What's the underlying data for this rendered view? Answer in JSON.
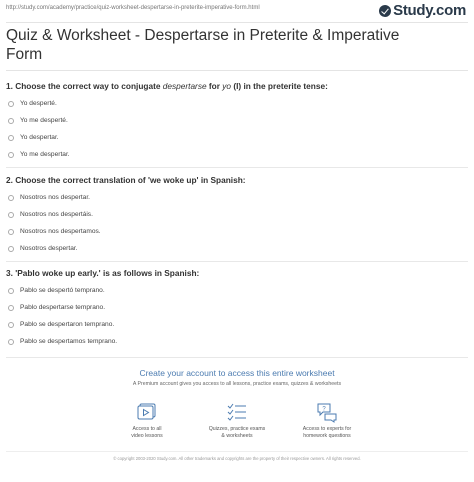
{
  "header": {
    "url": "http://study.com/academy/practice/quiz-worksheet-despertarse-in-preterite-imperative-form.html",
    "logo_text": "Study.com",
    "logo_icon": "study-checkmark-logo"
  },
  "title": "Quiz & Worksheet - Despertarse in Preterite & Imperative Form",
  "questions": [
    {
      "number": "1.",
      "text_pre": "Choose the correct way to conjugate ",
      "text_em1": "despertarse",
      "text_mid": " for ",
      "text_em2": "yo",
      "text_post": " (I) in the preterite tense:",
      "options": [
        "Yo desperté.",
        "Yo me desperté.",
        "Yo despertar.",
        "Yo me despertar."
      ]
    },
    {
      "number": "2.",
      "text": "Choose the correct translation of 'we woke up' in Spanish:",
      "options": [
        "Nosotros nos despertar.",
        "Nosotros nos despertáis.",
        "Nosotros nos despertamos.",
        "Nosotros despertar."
      ]
    },
    {
      "number": "3.",
      "text": "'Pablo woke up early.' is as follows in Spanish:",
      "options": [
        "Pablo se despertó temprano.",
        "Pablo despertarse temprano.",
        "Pablo se despertaron temprano.",
        "Pablo se despertamos temprano."
      ]
    }
  ],
  "promo": {
    "title": "Create your account to access this entire worksheet",
    "subtitle": "A Premium account gives you access to all lessons, practice exams, quizzes & worksheets",
    "features": [
      {
        "icon": "video-lessons-icon",
        "line1": "Access to all",
        "line2": "video lessons"
      },
      {
        "icon": "quizzes-checklist-icon",
        "line1": "Quizzes, practice exams",
        "line2": "& worksheets"
      },
      {
        "icon": "expert-chat-icon",
        "line1": "Access to experts for",
        "line2": "homework questions"
      }
    ]
  },
  "footer": "© copyright 2003-2020 Study.com. All other trademarks and copyrights are the property of their respective owners. All rights reserved."
}
